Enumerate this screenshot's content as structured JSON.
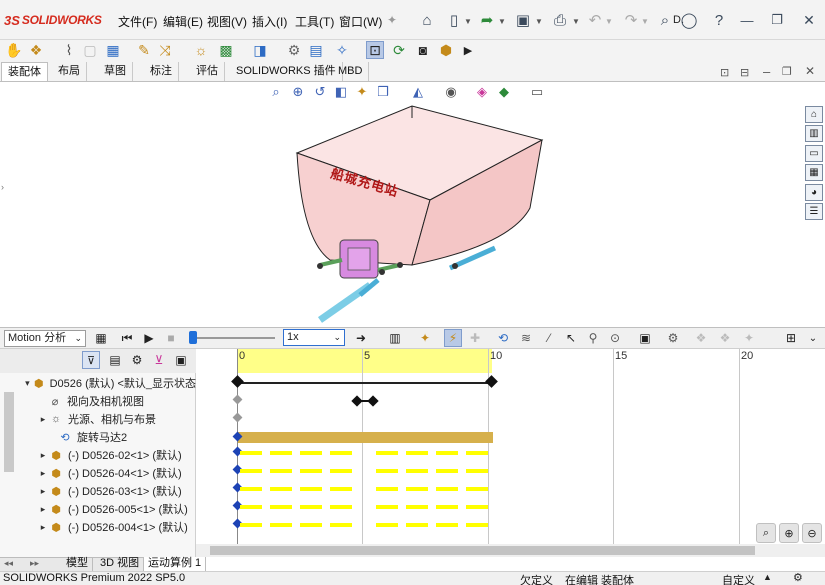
{
  "app": {
    "logo_prefix": "3S",
    "logo_name": "SOLIDWORKS"
  },
  "menu": [
    "文件(F)",
    "编辑(E)",
    "视图(V)",
    "插入(I)",
    "工具(T)",
    "窗口(W)"
  ],
  "titlebar": {
    "truncated_title": "D."
  },
  "command_tabs": [
    "装配体",
    "布局",
    "草图",
    "标注",
    "评估",
    "SOLIDWORKS 插件",
    "MBD"
  ],
  "model": {
    "label_text": "船城充电站"
  },
  "motion": {
    "study_type": "Motion 分析",
    "speed": "1x",
    "timeline_ticks": [
      "0",
      "5",
      "10",
      "15",
      "20"
    ],
    "keyframe_bar_color": "#d6b04c",
    "dash_color": "#ffff00",
    "header_highlight": "#ffff88"
  },
  "tree": {
    "root": "D0526 (默认) <默认_显示状态",
    "items": [
      "视向及相机视图",
      "光源、相机与布景",
      "旋转马达2",
      "(-) D0526-02<1> (默认)",
      "(-) D0526-04<1> (默认)",
      "(-) D0526-03<1> (默认)",
      "(-) D0526-005<1> (默认)",
      "(-) D0526-004<1> (默认)"
    ]
  },
  "bottom_tabs": [
    "模型",
    "3D 视图",
    "运动算例 1"
  ],
  "status": {
    "product": "SOLIDWORKS Premium 2022 SP5.0",
    "underdefined": "欠定义",
    "editing": "在编辑 装配体",
    "custom": "自定义"
  }
}
